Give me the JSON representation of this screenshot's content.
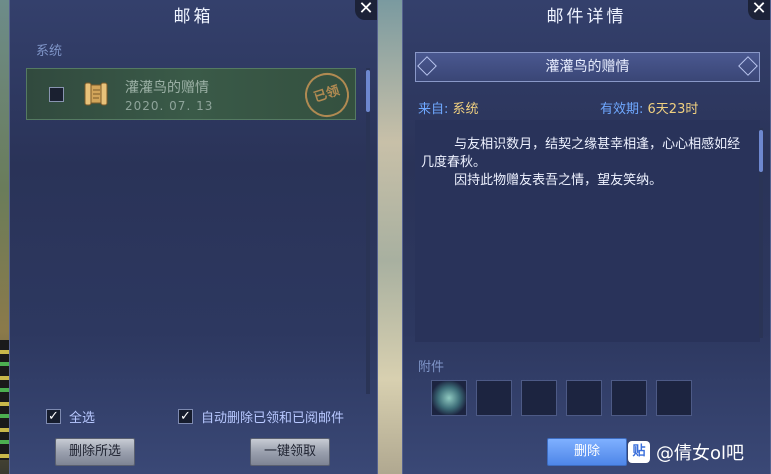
{
  "mailbox": {
    "title": "邮箱",
    "section": "系统",
    "mails": [
      {
        "subject": "灌灌鸟的赠情",
        "date": "2020. 07. 13",
        "status_stamp": "已领",
        "checked": false
      }
    ],
    "select_all_label": "全选",
    "select_all_checked": true,
    "auto_delete_label": "自动删除已领和已阅邮件",
    "auto_delete_checked": true,
    "delete_selected_label": "删除所选",
    "claim_all_label": "一键领取",
    "close_symbol": "✕"
  },
  "detail": {
    "title": "邮件详情",
    "subject": "灌灌鸟的赠情",
    "from_label": "来自:",
    "from_value": "系统",
    "valid_label": "有效期:",
    "valid_value": "6天23时",
    "body": "        与友相识数月，结契之缘甚幸相逢，心心相感如经几度春秋。\n        因持此物赠友表吾之情，望友笑纳。",
    "attachments_label": "附件",
    "attachment_slots": 6,
    "delete_label": "删除",
    "close_symbol": "✕"
  },
  "watermark": {
    "logo_text": "贴",
    "text": "@倩女ol吧"
  },
  "colors": {
    "label_blue": "#6fa8ff",
    "value_gold": "#f0d080",
    "primary_button": "#4e86e8",
    "claimed_stamp": "#b08a52"
  }
}
